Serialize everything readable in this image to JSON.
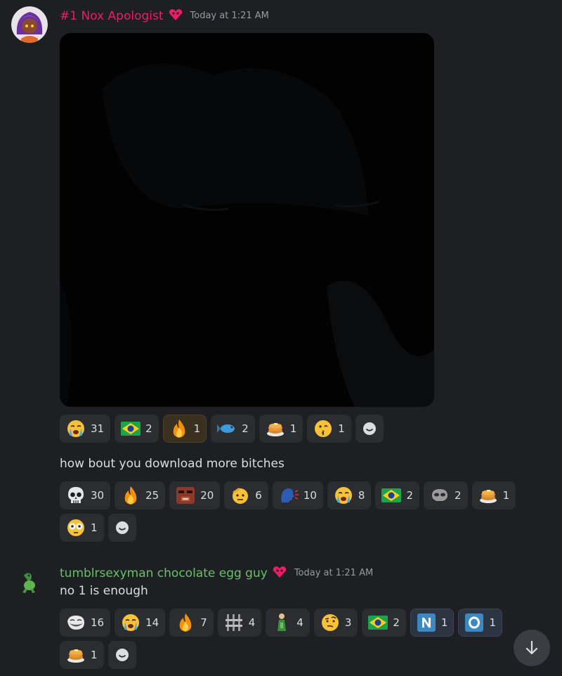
{
  "message1": {
    "username": "#1 Nox Apologist",
    "username_color": "#e91e63",
    "timestamp": "Today at 1:21 AM",
    "reactions": [
      {
        "icon": "crying-face-icon",
        "count": "31"
      },
      {
        "icon": "brazil-flag-icon",
        "count": "2"
      },
      {
        "icon": "fire-icon",
        "count": "1",
        "reacted": true
      },
      {
        "icon": "fish-icon",
        "count": "2"
      },
      {
        "icon": "pancakes-icon",
        "count": "1"
      },
      {
        "icon": "kissing-face-icon",
        "count": "1"
      }
    ]
  },
  "message2": {
    "text": "how bout you download more bitches",
    "reactions": [
      {
        "icon": "skull-icon",
        "count": "30"
      },
      {
        "icon": "fire-icon",
        "count": "25"
      },
      {
        "icon": "face-custom-emoji-icon",
        "count": "20"
      },
      {
        "icon": "saluting-face-icon",
        "count": "6"
      },
      {
        "icon": "speaking-head-icon",
        "count": "10"
      },
      {
        "icon": "crying-face-icon",
        "count": "8"
      },
      {
        "icon": "brazil-flag-icon",
        "count": "2"
      },
      {
        "icon": "skull-custom-emoji-icon",
        "count": "2"
      },
      {
        "icon": "pancakes-icon",
        "count": "1"
      },
      {
        "icon": "flushed-face-icon",
        "count": "1"
      }
    ]
  },
  "message3": {
    "username": "tumblrsexyman chocolate egg guy",
    "username_color": "#6abf69",
    "timestamp": "Today at 1:21 AM",
    "text": "no 1 is enough",
    "reactions": [
      {
        "icon": "trollface-icon",
        "count": "16"
      },
      {
        "icon": "crying-face-icon",
        "count": "14"
      },
      {
        "icon": "fire-icon",
        "count": "7"
      },
      {
        "icon": "bars-custom-emoji-icon",
        "count": "4"
      },
      {
        "icon": "bottle-man-custom-emoji-icon",
        "count": "4"
      },
      {
        "icon": "raised-eyebrow-face-icon",
        "count": "3"
      },
      {
        "icon": "brazil-flag-icon",
        "count": "2"
      },
      {
        "icon": "letter-n-icon",
        "count": "1",
        "blue": true
      },
      {
        "icon": "letter-o-icon",
        "count": "1",
        "blue": true
      },
      {
        "icon": "pancakes-icon",
        "count": "1"
      }
    ]
  },
  "colors": {
    "background": "#1e1f22",
    "reaction_bg": "#2b2d31",
    "timestamp": "#949ba4",
    "text": "#dbdee1"
  }
}
